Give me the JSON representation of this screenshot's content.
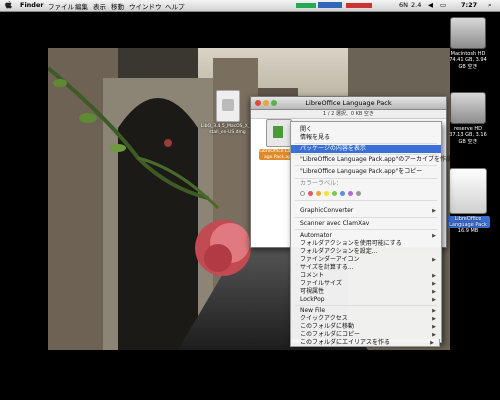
{
  "menubar": {
    "app_name": "Finder",
    "items": [
      "ファイル",
      "編集",
      "表示",
      "移動",
      "ウインドウ",
      "ヘルプ"
    ],
    "clock": "7:27",
    "status_a": "6N",
    "status_b": "2.4"
  },
  "desktop": {
    "disks": [
      {
        "name": "Macintosh HD",
        "info": "74.41 GB, 3.94 GB 空き"
      },
      {
        "name": "reserve HD",
        "info": "37.13 GB, 3.16 GB 空き"
      },
      {
        "name": "LibreOffice Language Pack",
        "info": "16.9 MB"
      }
    ],
    "file_icon": {
      "label": "LibO_3.4.5_MacOS_X_install_en-US.dmg"
    }
  },
  "finder": {
    "title": "LibreOffice Language Pack",
    "status": "1 / 2 選択、0 KB 空き",
    "item_label": "LibreOffice Language Pack.app"
  },
  "context_menu": {
    "open": "開く",
    "get_info": "情報を見る",
    "show_package": "パッケージの内容を表示",
    "archive": "\"LibreOffice Language Pack.app\"のアーカイブを作成",
    "copy": "\"LibreOffice Language Pack.app\"をコピー",
    "color_label": "カラーラベル：",
    "graphicconverter": "GraphicConverter",
    "clamxav": "Scanner avec ClamXav",
    "automator": "Automator",
    "enable_folder_actions": "フォルダアクションを使用可能にする",
    "folder_actions_setup": "フォルダアクションを設定...",
    "finder_icon": "ファインダーアイコン",
    "calc_size": "サイズを計算する...",
    "comment": "コメント",
    "file_size": "ファイルサイズ",
    "visibility": "可視属性",
    "lockpop": "LockPop",
    "new_file": "New File",
    "quick_access": "クイックアクセス",
    "move_to_folder": "このフォルダに移動",
    "copy_to_folder": "このフォルダにコピー",
    "alias_in_folder": "このフォルダにエイリアスを作る"
  },
  "colors": {
    "selection": "#3b6fd6",
    "labels": [
      "#e05a5a",
      "#f3a43a",
      "#f3e03a",
      "#77c94a",
      "#5a8fe0",
      "#b06ad8",
      "#999999"
    ]
  }
}
